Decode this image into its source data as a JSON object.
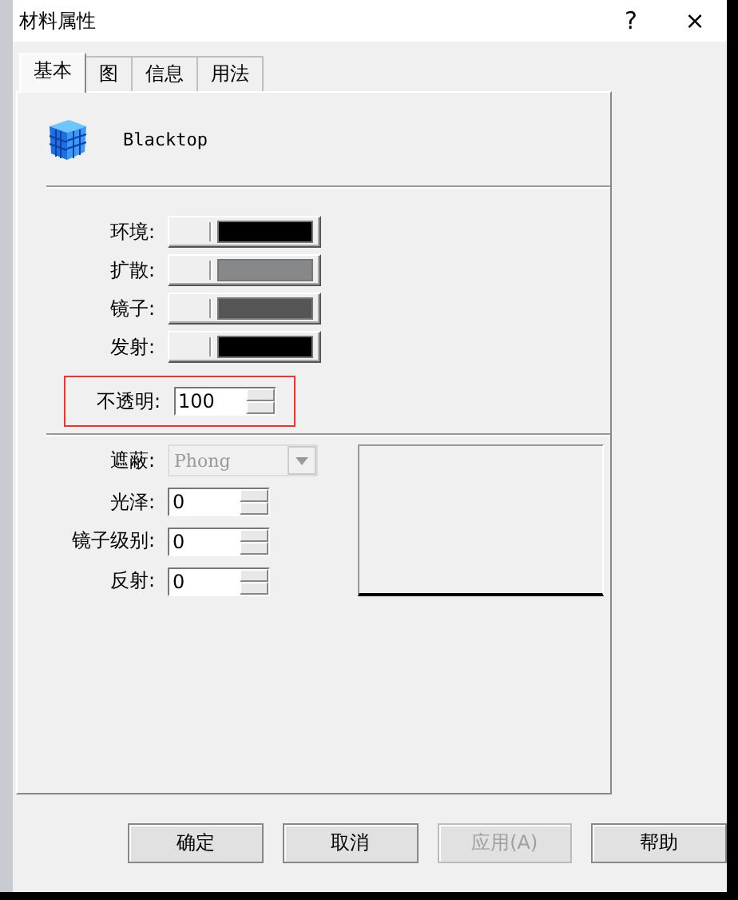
{
  "window": {
    "title": "材料属性",
    "help": "?",
    "close": "×"
  },
  "tabs": [
    {
      "label": "基本",
      "selected": true
    },
    {
      "label": "图",
      "selected": false
    },
    {
      "label": "信息",
      "selected": false
    },
    {
      "label": "用法",
      "selected": false
    }
  ],
  "material": {
    "name": "Blacktop"
  },
  "colors": [
    {
      "label": "环境:",
      "color": "#000000"
    },
    {
      "label": "扩散:",
      "color": "#87888a"
    },
    {
      "label": "镜子:",
      "color": "#555555"
    },
    {
      "label": "发射:",
      "color": "#000000"
    }
  ],
  "opacity": {
    "label": "不透明:",
    "value": "100",
    "highlighted": true
  },
  "shading": {
    "label": "遮蔽:",
    "value": "Phong",
    "disabled": true
  },
  "spinners": [
    {
      "label": "光泽:",
      "value": "0"
    },
    {
      "label": "镜子级别:",
      "value": "0"
    },
    {
      "label": "反射:",
      "value": "0"
    }
  ],
  "buttons": [
    {
      "label": "确定",
      "disabled": false
    },
    {
      "label": "取消",
      "disabled": false
    },
    {
      "label": "应用(A)",
      "disabled": true
    },
    {
      "label": "帮助",
      "disabled": false
    }
  ]
}
